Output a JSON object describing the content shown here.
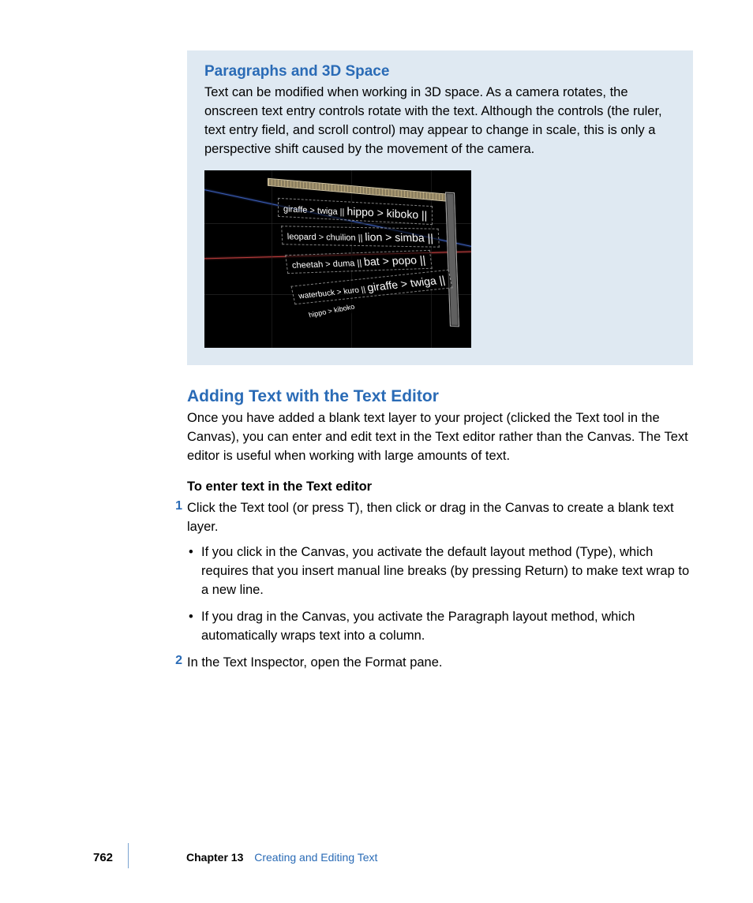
{
  "callout": {
    "heading": "Paragraphs and 3D Space",
    "body": "Text can be modified when working in 3D space. As a camera rotates, the onscreen text entry controls rotate with the text. Although the controls (the ruler, text entry field, and scroll control) may appear to change in scale, this is only a perspective shift caused by the movement of the camera."
  },
  "screenshot_rows": {
    "r1a": "giraffe > twiga ||",
    "r1b": "hippo > kiboko ||",
    "r2a": "leopard > chuilion ||",
    "r2b": "lion > simba ||",
    "r3a": "cheetah > duma ||",
    "r3b": "bat > popo ||",
    "r4a": "waterbuck > kuro ||",
    "r4b": "giraffe > twiga ||",
    "r5": "hippo > kiboko"
  },
  "section": {
    "heading": "Adding Text with the Text Editor",
    "intro": "Once you have added a blank text layer to your project (clicked the Text tool in the Canvas), you can enter and edit text in the Text editor rather than the Canvas. The Text editor is useful when working with large amounts of text.",
    "subhead": "To enter text in the Text editor",
    "steps": [
      {
        "num": "1",
        "text": "Click the Text tool (or press T), then click or drag in the Canvas to create a blank text layer."
      },
      {
        "num": "2",
        "text": "In the Text Inspector, open the Format pane."
      }
    ],
    "bullets": [
      "If you click in the Canvas, you activate the default layout method (Type), which requires that you insert manual line breaks (by pressing Return) to make text wrap to a new line.",
      "If you drag in the Canvas, you activate the Paragraph layout method, which automatically wraps text into a column."
    ]
  },
  "footer": {
    "page": "762",
    "chapter_label": "Chapter 13",
    "chapter_title": "Creating and Editing Text"
  }
}
